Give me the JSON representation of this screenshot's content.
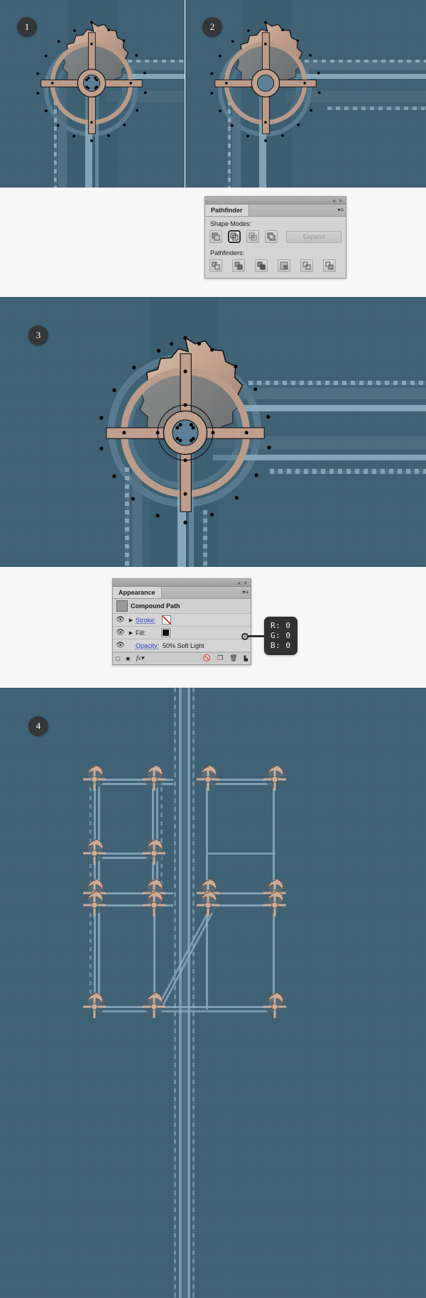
{
  "steps": [
    {
      "id": "1",
      "label": "1"
    },
    {
      "id": "2",
      "label": "2"
    },
    {
      "id": "3",
      "label": "3"
    },
    {
      "id": "4",
      "label": "4"
    }
  ],
  "pathfinder_panel": {
    "title": "Pathfinder",
    "titlebar_controls": "«  ×",
    "menu_icon": "▾≡",
    "shape_modes_label": "Shape Modes:",
    "pathfinders_label": "Pathfinders:",
    "expand_label": "Expand",
    "shape_mode_buttons": [
      {
        "name": "unite",
        "selected": false
      },
      {
        "name": "minus-front",
        "selected": true
      },
      {
        "name": "intersect",
        "selected": false
      },
      {
        "name": "exclude",
        "selected": false
      }
    ],
    "pathfinder_buttons": [
      {
        "name": "divide"
      },
      {
        "name": "trim"
      },
      {
        "name": "merge"
      },
      {
        "name": "crop"
      },
      {
        "name": "outline"
      },
      {
        "name": "minus-back"
      }
    ]
  },
  "appearance_panel": {
    "title": "Appearance",
    "titlebar_controls": "«  ×",
    "menu_icon": "▾≡",
    "object_type": "Compound Path",
    "rows": [
      {
        "name": "stroke",
        "label": "Stroke:",
        "swatch": "none",
        "eye": true,
        "arrow": true
      },
      {
        "name": "fill",
        "label": "Fill:",
        "swatch": "black",
        "eye": true,
        "arrow": true
      },
      {
        "name": "opacity",
        "label": "Opacity:",
        "value": "50% Soft Light",
        "eye": true,
        "arrow": false
      }
    ],
    "footer_icons": [
      "add-new-stroke-icon",
      "add-new-fill-icon",
      "add-new-effect-icon",
      "clear-appearance-icon",
      "duplicate-item-icon",
      "delete-item-icon"
    ]
  },
  "callout": {
    "r_label": "R: 0",
    "g_label": "G: 0",
    "b_label": "B: 0"
  },
  "colors": {
    "canvas_bg": "#3f6175",
    "pipe_mid": "#557386",
    "pipe_light": "#8fb0c2",
    "dash": "#9bb9ca",
    "gear_metal_light": "#cfb2a0",
    "gear_metal_dark": "#9b7f6f",
    "gear_outline": "#111111",
    "badge_bg": "#33373a",
    "panel_bg": "#d4d4d4",
    "link_blue": "#2b44c8",
    "swatch_none_slash": "#d42b2b"
  }
}
